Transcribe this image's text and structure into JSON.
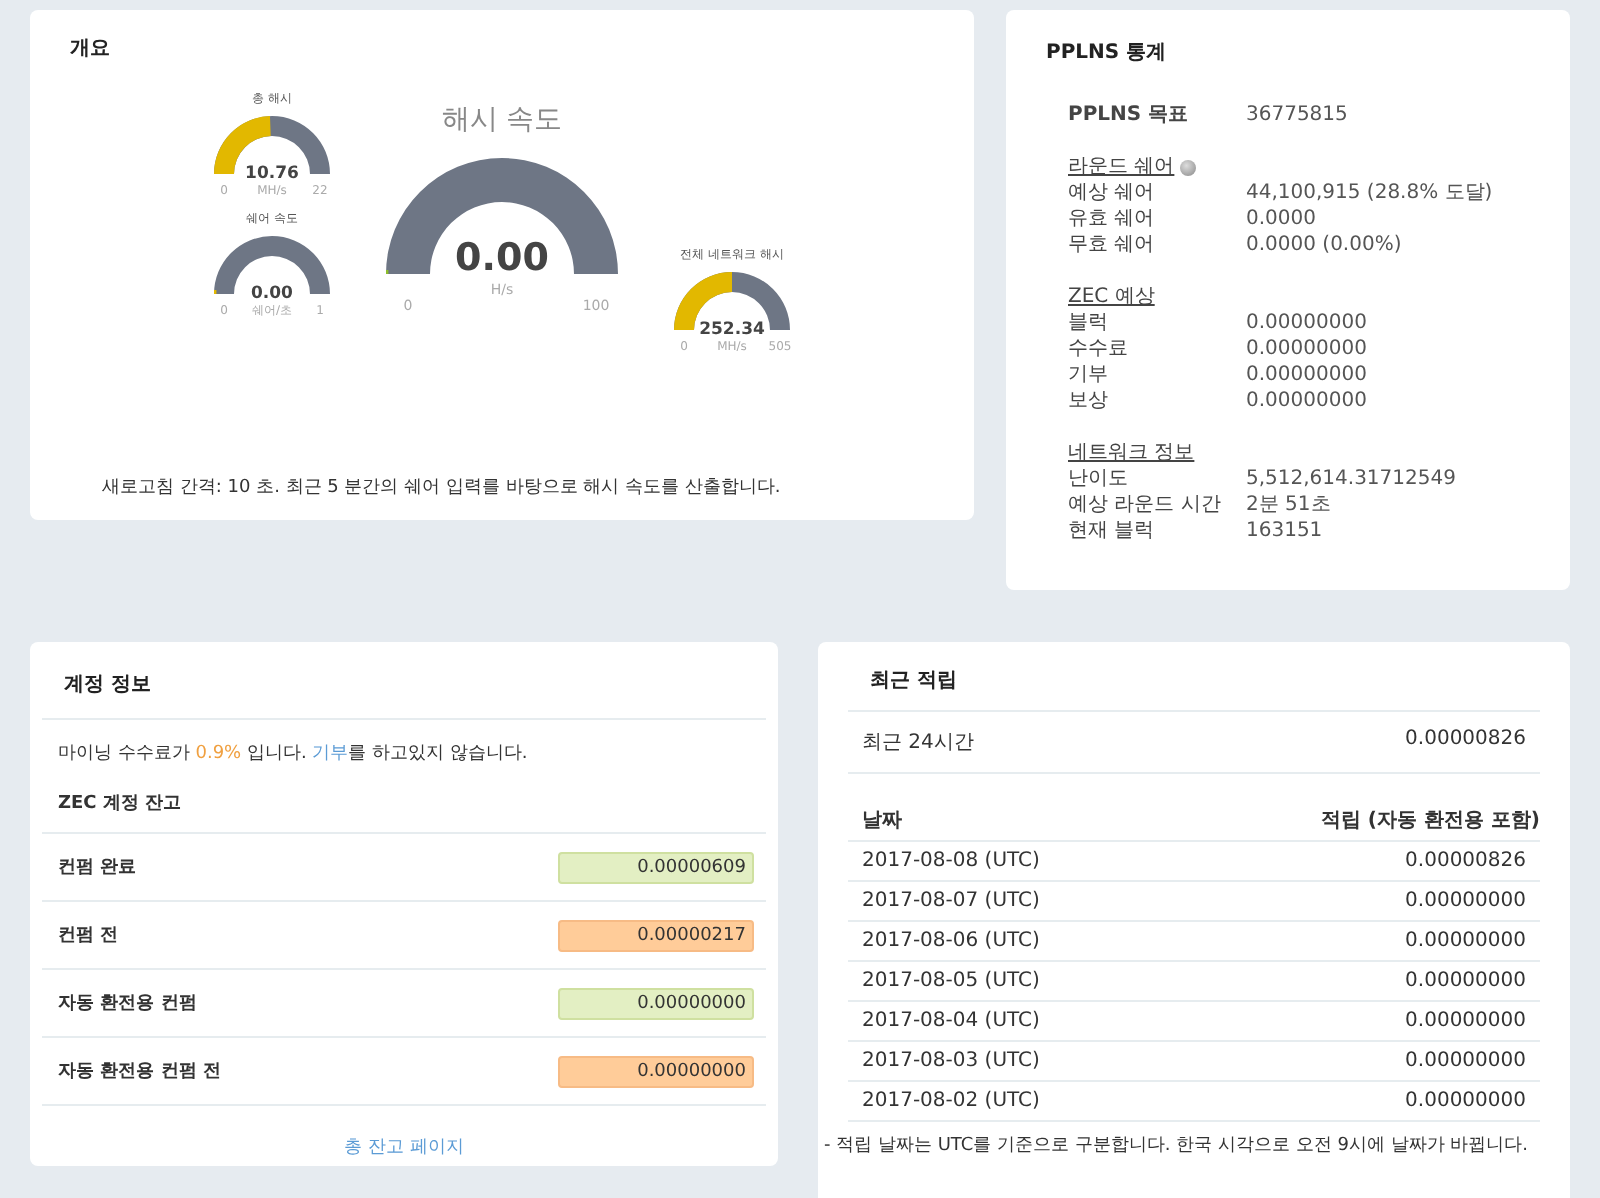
{
  "overview": {
    "title": "개요",
    "gauge_columns": [
      [
        {
          "kind": "small",
          "title": "총 해시",
          "value": "10.76",
          "unit": "MH/s",
          "min": "0",
          "max": "22",
          "level": 0.489,
          "color": "#e2b800"
        },
        {
          "kind": "small",
          "title": "쉐어 속도",
          "value": "0.00",
          "unit": "쉐어/초",
          "min": "0",
          "max": "1",
          "level": 0,
          "color": "#e2b800"
        }
      ],
      [
        {
          "kind": "large",
          "title": "해시 속도",
          "value": "0.00",
          "unit": "H/s",
          "min": "0",
          "max": "100",
          "level": 0,
          "color": "#8cbd2a"
        }
      ],
      [
        {
          "kind": "small",
          "title": "전체 네트워크 해시",
          "value": "252.34",
          "unit": "MH/s",
          "min": "0",
          "max": "505",
          "level": 0.5,
          "color": "#e2b800"
        }
      ]
    ],
    "note": "새로고침 간격: 10 초. 최근 5 분간의 쉐어 입력를 바탕으로 해시 속도를 산출합니다."
  },
  "pplns": {
    "title": "PPLNS 통계",
    "target": {
      "label": "PPLNS 목표",
      "value": "36775815"
    },
    "sections": [
      {
        "title": "라운드 쉐어",
        "help": true,
        "rows": [
          {
            "label": "예상 쉐어",
            "value": "44,100,915 (28.8% 도달)"
          },
          {
            "label": "유효 쉐어",
            "value": "0.0000"
          },
          {
            "label": "무효 쉐어",
            "value": "0.0000 (0.00%)"
          }
        ]
      },
      {
        "title": "ZEC 예상",
        "help": false,
        "rows": [
          {
            "label": "블럭",
            "value": "0.00000000"
          },
          {
            "label": "수수료",
            "value": "0.00000000"
          },
          {
            "label": "기부",
            "value": "0.00000000"
          },
          {
            "label": "보상",
            "value": "0.00000000"
          }
        ]
      },
      {
        "title": "네트워크 정보",
        "help": false,
        "rows": [
          {
            "label": "난이도",
            "value": "5,512,614.31712549"
          },
          {
            "label": "예상 라운드 시간",
            "value": "2분 51초"
          },
          {
            "label": "현재 블럭",
            "value": "163151"
          }
        ]
      }
    ]
  },
  "account": {
    "title": "계정 정보",
    "fee_line": {
      "prefix": "마이닝 수수료가 ",
      "fee": "0.9%",
      "middle": " 입니다.  ",
      "link": "기부",
      "suffix": "를 하고있지 않습니다."
    },
    "balance_title": "ZEC 계정 잔고",
    "balances": [
      {
        "label": "컨펌 완료",
        "value": "0.00000609",
        "kind": "confirmed"
      },
      {
        "label": "컨펌 전",
        "value": "0.00000217",
        "kind": "unconfirmed"
      },
      {
        "label": "자동 환전용 컨펌",
        "value": "0.00000000",
        "kind": "confirmed"
      },
      {
        "label": "자동 환전용 컨펌 전",
        "value": "0.00000000",
        "kind": "unconfirmed"
      }
    ],
    "link": "총 잔고 페이지"
  },
  "earnings": {
    "title": "최근 적립",
    "last24": {
      "label": "최근 24시간",
      "value": "0.00000826"
    },
    "columns": [
      "날짜",
      "적립 (자동 환전용 포함)"
    ],
    "rows": [
      [
        "2017-08-08 (UTC)",
        "0.00000826"
      ],
      [
        "2017-08-07 (UTC)",
        "0.00000000"
      ],
      [
        "2017-08-06 (UTC)",
        "0.00000000"
      ],
      [
        "2017-08-05 (UTC)",
        "0.00000000"
      ],
      [
        "2017-08-04 (UTC)",
        "0.00000000"
      ],
      [
        "2017-08-03 (UTC)",
        "0.00000000"
      ],
      [
        "2017-08-02 (UTC)",
        "0.00000000"
      ]
    ],
    "footnote": "- 적립 날짜는 UTC를 기준으로 구분합니다. 한국 시각으로 오전 9시에 날짜가 바뀝니다."
  }
}
